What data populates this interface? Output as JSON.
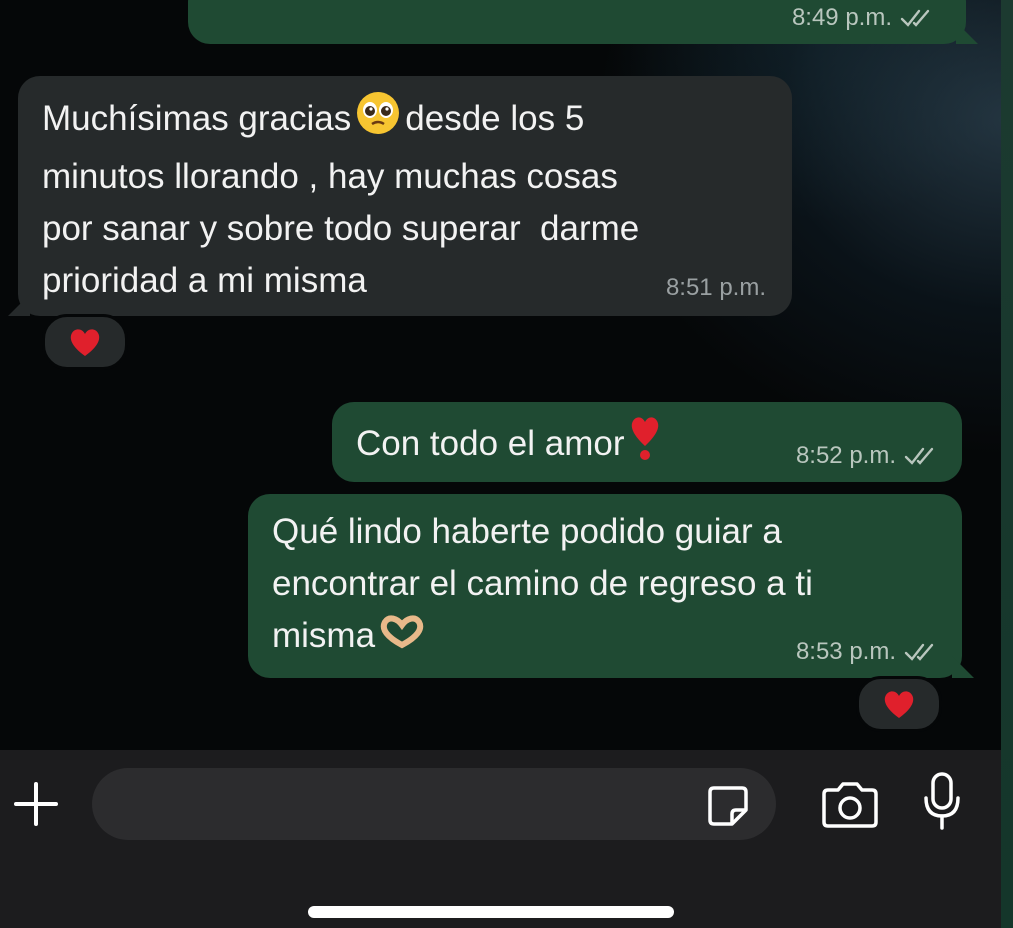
{
  "messages": [
    {
      "id": "m0",
      "direction": "outgoing",
      "text": "",
      "time": "8:49 p.m.",
      "read": true
    },
    {
      "id": "m1",
      "direction": "incoming",
      "text_parts": [
        "Muchísimas gracias",
        "desde los 5\nminutos llorando , hay muchas cosas\npor sanar y sobre todo superar  darme\nprioridad a mi misma"
      ],
      "emoji": "pleading-face",
      "time": "8:51 p.m.",
      "reaction": "red-heart"
    },
    {
      "id": "m2",
      "direction": "outgoing",
      "text": "Con todo el amor",
      "emoji": "heart-exclamation",
      "time": "8:52 p.m.",
      "read": true
    },
    {
      "id": "m3",
      "direction": "outgoing",
      "text": "Qué lindo haberte podido guiar a\nencontrar el camino de regreso a ti\nmisma",
      "emoji": "heart-hands",
      "time": "8:53 p.m.",
      "read": true,
      "reaction": "red-heart"
    }
  ],
  "composer": {
    "placeholder": "",
    "icons": [
      "plus-icon",
      "sticker-icon",
      "camera-icon",
      "microphone-icon"
    ]
  },
  "colors": {
    "outgoing_bubble": "#1f4a33",
    "incoming_bubble": "#262a2b",
    "read_ticks": "#b9c6be",
    "bottom_bar": "#1c1c1e"
  }
}
